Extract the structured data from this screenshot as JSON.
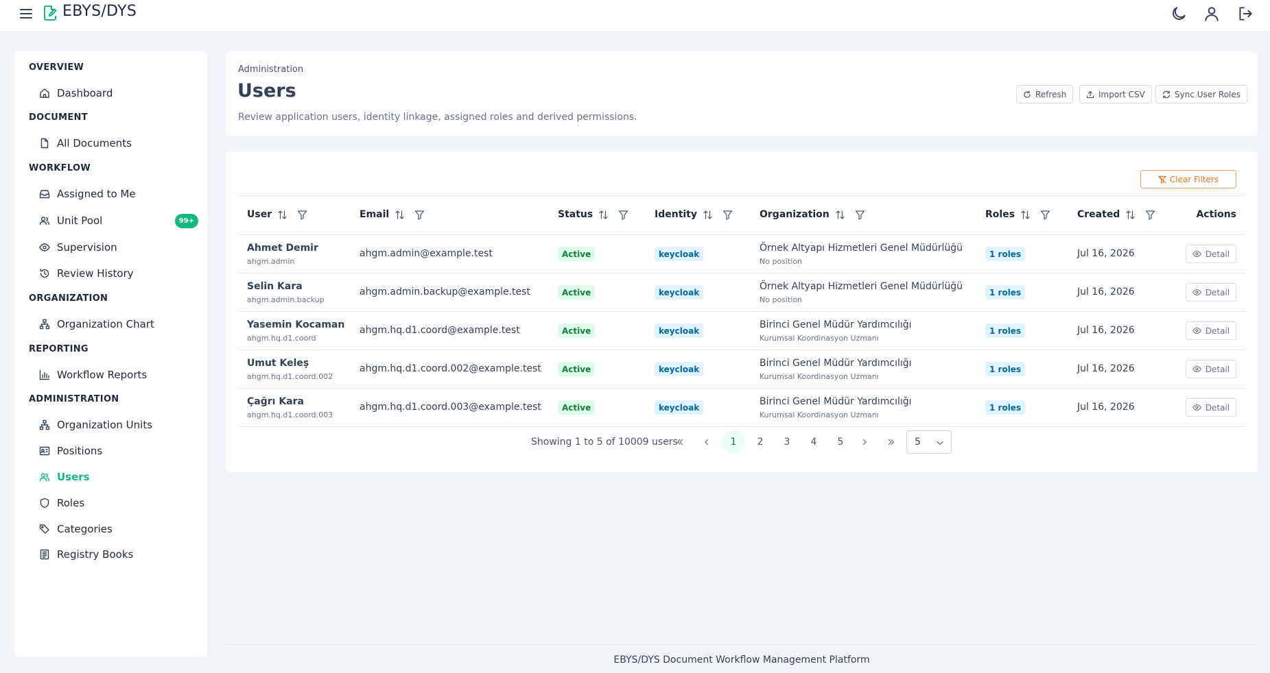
{
  "app": {
    "title": "EBYS/DYS"
  },
  "sidebar": {
    "sections": {
      "overview": "OVERVIEW",
      "document": "DOCUMENT",
      "workflow": "WORKFLOW",
      "organization": "ORGANIZATION",
      "reporting": "REPORTING",
      "administration": "ADMINISTRATION"
    },
    "items": {
      "dashboard": "Dashboard",
      "all_documents": "All Documents",
      "assigned_to_me": "Assigned to Me",
      "unit_pool": "Unit Pool",
      "unit_pool_badge": "99+",
      "supervision": "Supervision",
      "review_history": "Review History",
      "organization_chart": "Organization Chart",
      "workflow_reports": "Workflow Reports",
      "organization_units": "Organization Units",
      "positions": "Positions",
      "users": "Users",
      "roles": "Roles",
      "categories": "Categories",
      "registry_books": "Registry Books"
    },
    "accent_color": "#10b981"
  },
  "header": {
    "breadcrumb": "Administration",
    "title": "Users",
    "description": "Review application users, identity linkage, assigned roles and derived permissions.",
    "buttons": {
      "refresh": "Refresh",
      "import_csv": "Import CSV",
      "sync_roles": "Sync User Roles"
    }
  },
  "table": {
    "clear_filters": "Clear Filters",
    "columns": {
      "user": "User",
      "email": "Email",
      "status": "Status",
      "identity": "Identity",
      "organization": "Organization",
      "roles": "Roles",
      "created": "Created",
      "actions": "Actions"
    },
    "detail_label": "Detail",
    "rows": [
      {
        "name": "Ahmet Demir",
        "login": "ahgm.admin",
        "email": "ahgm.admin@example.test",
        "status": "Active",
        "identity": "keycloak",
        "org": "Örnek Altyapı Hizmetleri Genel Müdürlüğü",
        "position": "No position",
        "roles": "1 roles",
        "created": "Jul 16, 2026"
      },
      {
        "name": "Selin Kara",
        "login": "ahgm.admin.backup",
        "email": "ahgm.admin.backup@example.test",
        "status": "Active",
        "identity": "keycloak",
        "org": "Örnek Altyapı Hizmetleri Genel Müdürlüğü",
        "position": "No position",
        "roles": "1 roles",
        "created": "Jul 16, 2026"
      },
      {
        "name": "Yasemin Kocaman",
        "login": "ahgm.hq.d1.coord",
        "email": "ahgm.hq.d1.coord@example.test",
        "status": "Active",
        "identity": "keycloak",
        "org": "Birinci Genel Müdür Yardımcılığı",
        "position": "Kurumsal Koordinasyon Uzmanı",
        "roles": "1 roles",
        "created": "Jul 16, 2026"
      },
      {
        "name": "Umut Keleş",
        "login": "ahgm.hq.d1.coord.002",
        "email": "ahgm.hq.d1.coord.002@example.test",
        "status": "Active",
        "identity": "keycloak",
        "org": "Birinci Genel Müdür Yardımcılığı",
        "position": "Kurumsal Koordinasyon Uzmanı",
        "roles": "1 roles",
        "created": "Jul 16, 2026"
      },
      {
        "name": "Çağrı Kara",
        "login": "ahgm.hq.d1.coord.003",
        "email": "ahgm.hq.d1.coord.003@example.test",
        "status": "Active",
        "identity": "keycloak",
        "org": "Birinci Genel Müdür Yardımcılığı",
        "position": "Kurumsal Koordinasyon Uzmanı",
        "roles": "1 roles",
        "created": "Jul 16, 2026"
      }
    ]
  },
  "pagination": {
    "summary": "Showing 1 to 5 of 10009 users",
    "pages": [
      "1",
      "2",
      "3",
      "4",
      "5"
    ],
    "current": "1",
    "per_page": "5"
  },
  "footer": {
    "text": "EBYS/DYS Document Workflow Management Platform"
  },
  "colors": {
    "status_active_bg": "#dcfce7",
    "status_active_fg": "#15803d",
    "info_bg": "#e0f2fe",
    "info_fg": "#0369a1",
    "warning": "#f97316"
  }
}
